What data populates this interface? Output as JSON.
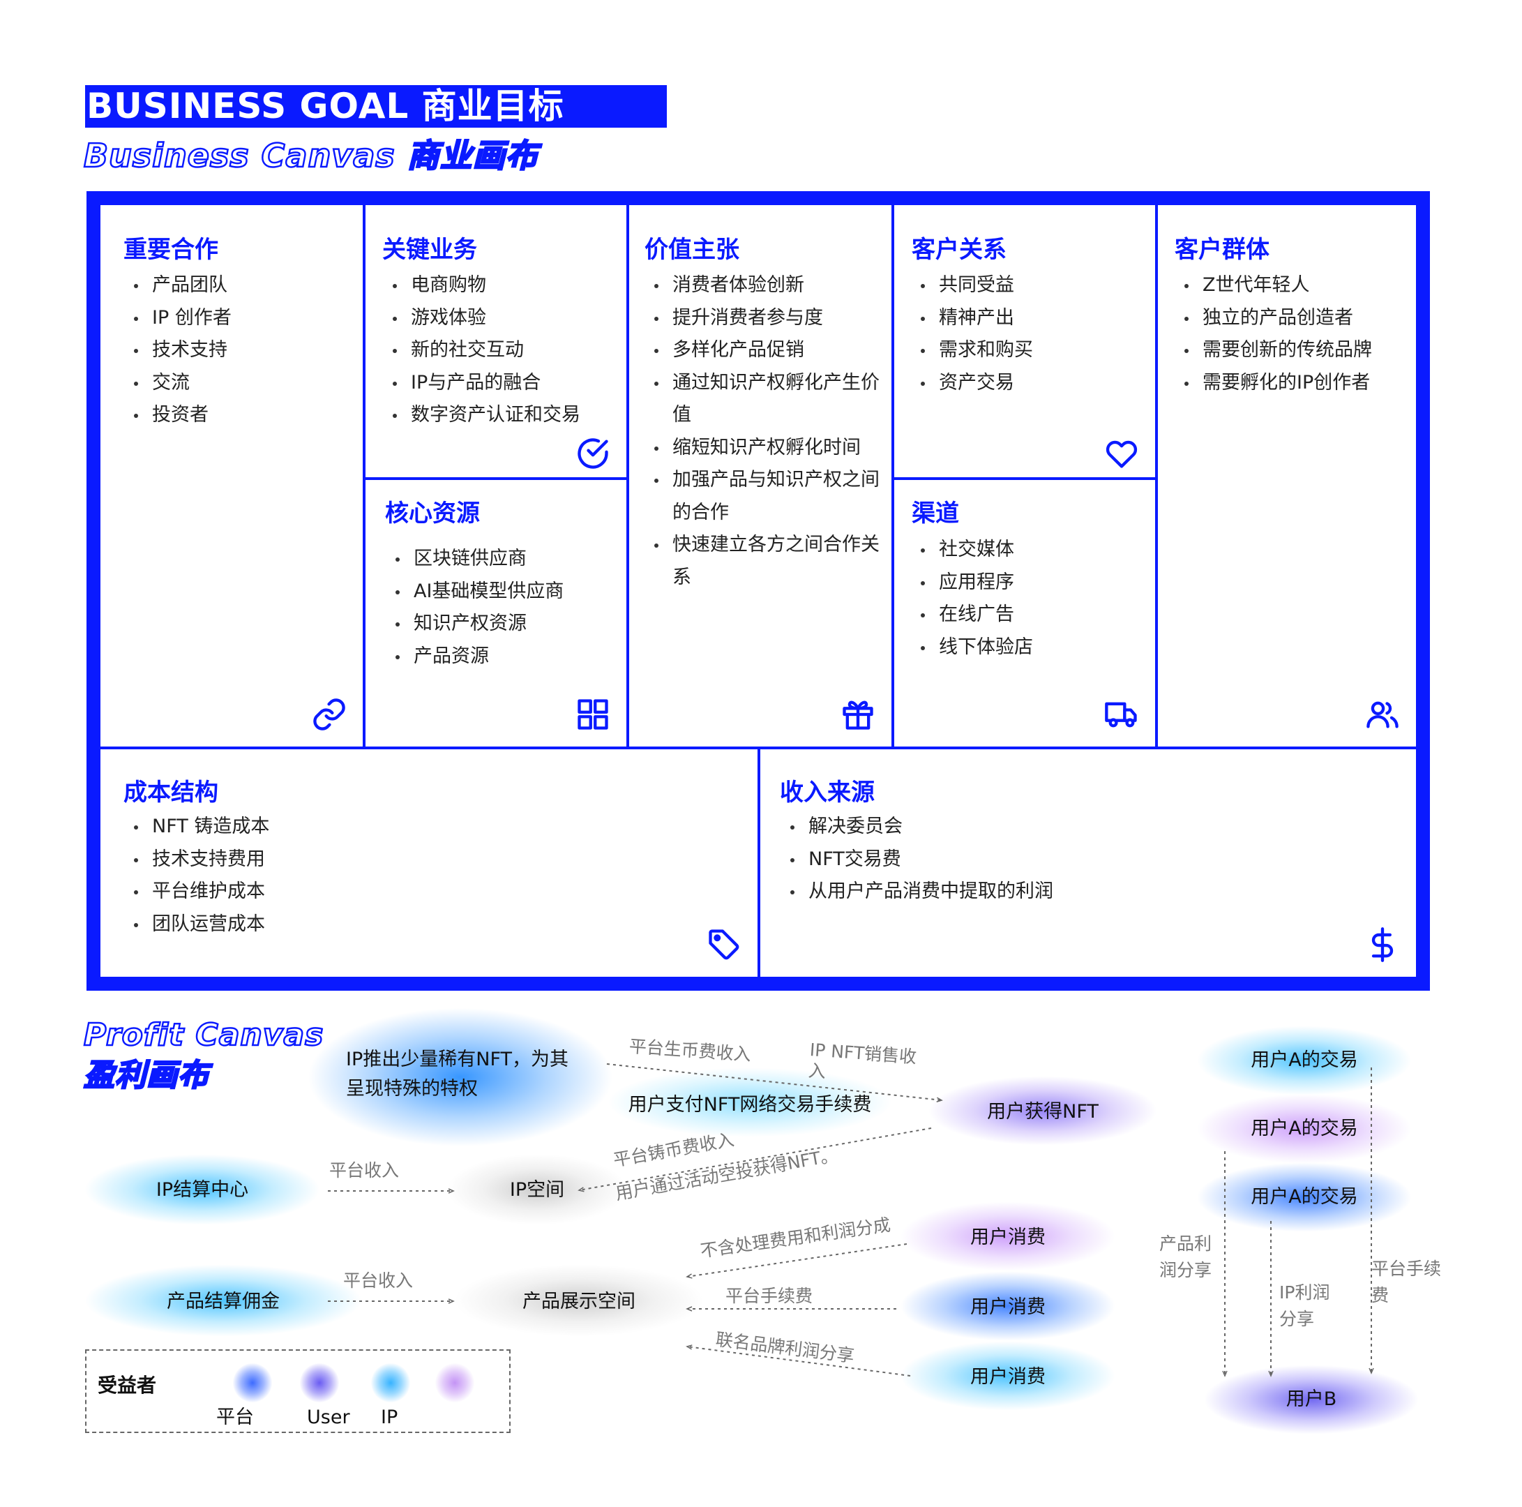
{
  "header": {
    "title": "BUSINESS  GOAL   商业目标",
    "business_canvas_title": "Business Canvas  商业画布",
    "profit_canvas_title_en": "Profit Canvas",
    "profit_canvas_title_cn": "盈利画布"
  },
  "colors": {
    "accent": "#0a1aff",
    "platform": "#3d6bff",
    "user": "#6a5cf2",
    "ip": "#37b3ff",
    "other": "#c494f5"
  },
  "canvas": {
    "key_partners": {
      "title": "重要合作",
      "items": [
        "产品团队",
        "IP 创作者",
        "技术支持",
        "交流",
        "投资者"
      ],
      "icon": "link-icon"
    },
    "key_activities": {
      "title": "关键业务",
      "items": [
        "电商购物",
        "游戏体验",
        "新的社交互动",
        "IP与产品的融合",
        "数字资产认证和交易"
      ],
      "icon": "check-circle-icon"
    },
    "key_resources": {
      "title": "核心资源",
      "items": [
        "区块链供应商",
        "AI基础模型供应商",
        "知识产权资源",
        "产品资源"
      ],
      "icon": "grid-icon"
    },
    "value_propositions": {
      "title": "价值主张",
      "items": [
        "消费者体验创新",
        "提升消费者参与度",
        "多样化产品促销",
        "通过知识产权孵化产生价值",
        "缩短知识产权孵化时间",
        "加强产品与知识产权之间的合作",
        "快速建立各方之间合作关系"
      ],
      "icon": "gift-icon"
    },
    "customer_relationships": {
      "title": "客户关系",
      "items": [
        "共同受益",
        "精神产出",
        "需求和购买",
        "资产交易"
      ],
      "icon": "heart-icon"
    },
    "channels": {
      "title": "渠道",
      "items": [
        "社交媒体",
        "应用程序",
        "在线广告",
        "线下体验店"
      ],
      "icon": "truck-icon"
    },
    "customer_segments": {
      "title": "客户群体",
      "items": [
        "Z世代年轻人",
        "独立的产品创造者",
        "需要创新的传统品牌",
        "需要孵化的IP创作者"
      ],
      "icon": "users-icon"
    },
    "cost_structure": {
      "title": "成本结构",
      "items": [
        "NFT 铸造成本",
        "技术支持费用",
        "平台维护成本",
        "团队运营成本"
      ],
      "icon": "tag-icon"
    },
    "revenue_streams": {
      "title": "收入来源",
      "items": [
        "解决委员会",
        "NFT交易费",
        "从用户产品消费中提取的利润"
      ],
      "icon": "dollar-icon"
    }
  },
  "profit": {
    "nodes": {
      "ip_launch": "IP推出少量稀有NFT，为其呈现特殊的特权",
      "user_pays_fee": "用户支付NFT网络交易手续费",
      "user_gets_nft": "用户获得NFT",
      "ip_settlement": "IP结算中心",
      "ip_space": "IP空间",
      "product_commission": "产品结算佣金",
      "product_display": "产品展示空间",
      "user_consume_1": "用户消费",
      "user_consume_2": "用户消费",
      "user_consume_3": "用户消费",
      "user_a_tx_1": "用户A的交易",
      "user_a_tx_2": "用户A的交易",
      "user_a_tx_3": "用户A的交易",
      "user_b": "用户B"
    },
    "edges": {
      "platform_coin_fee": "平台生币费收入",
      "ip_nft_sales": "IP NFT销售收入",
      "platform_mint_fee": "平台铸币费收入",
      "airdrop": "用户通过活动空投获得NFT。",
      "platform_income_1": "平台收入",
      "platform_income_2": "平台收入",
      "excl_fees": "不含处理费用和利润分成",
      "platform_fee": "平台手续费",
      "cobrand_share": "联名品牌利润分享",
      "product_profit_share": "产品利润分享",
      "ip_profit_share": "IP利润分享",
      "platform_handling_fee": "平台手续费"
    }
  },
  "legend": {
    "title": "受益者",
    "items": [
      "平台",
      "User",
      "IP"
    ]
  }
}
